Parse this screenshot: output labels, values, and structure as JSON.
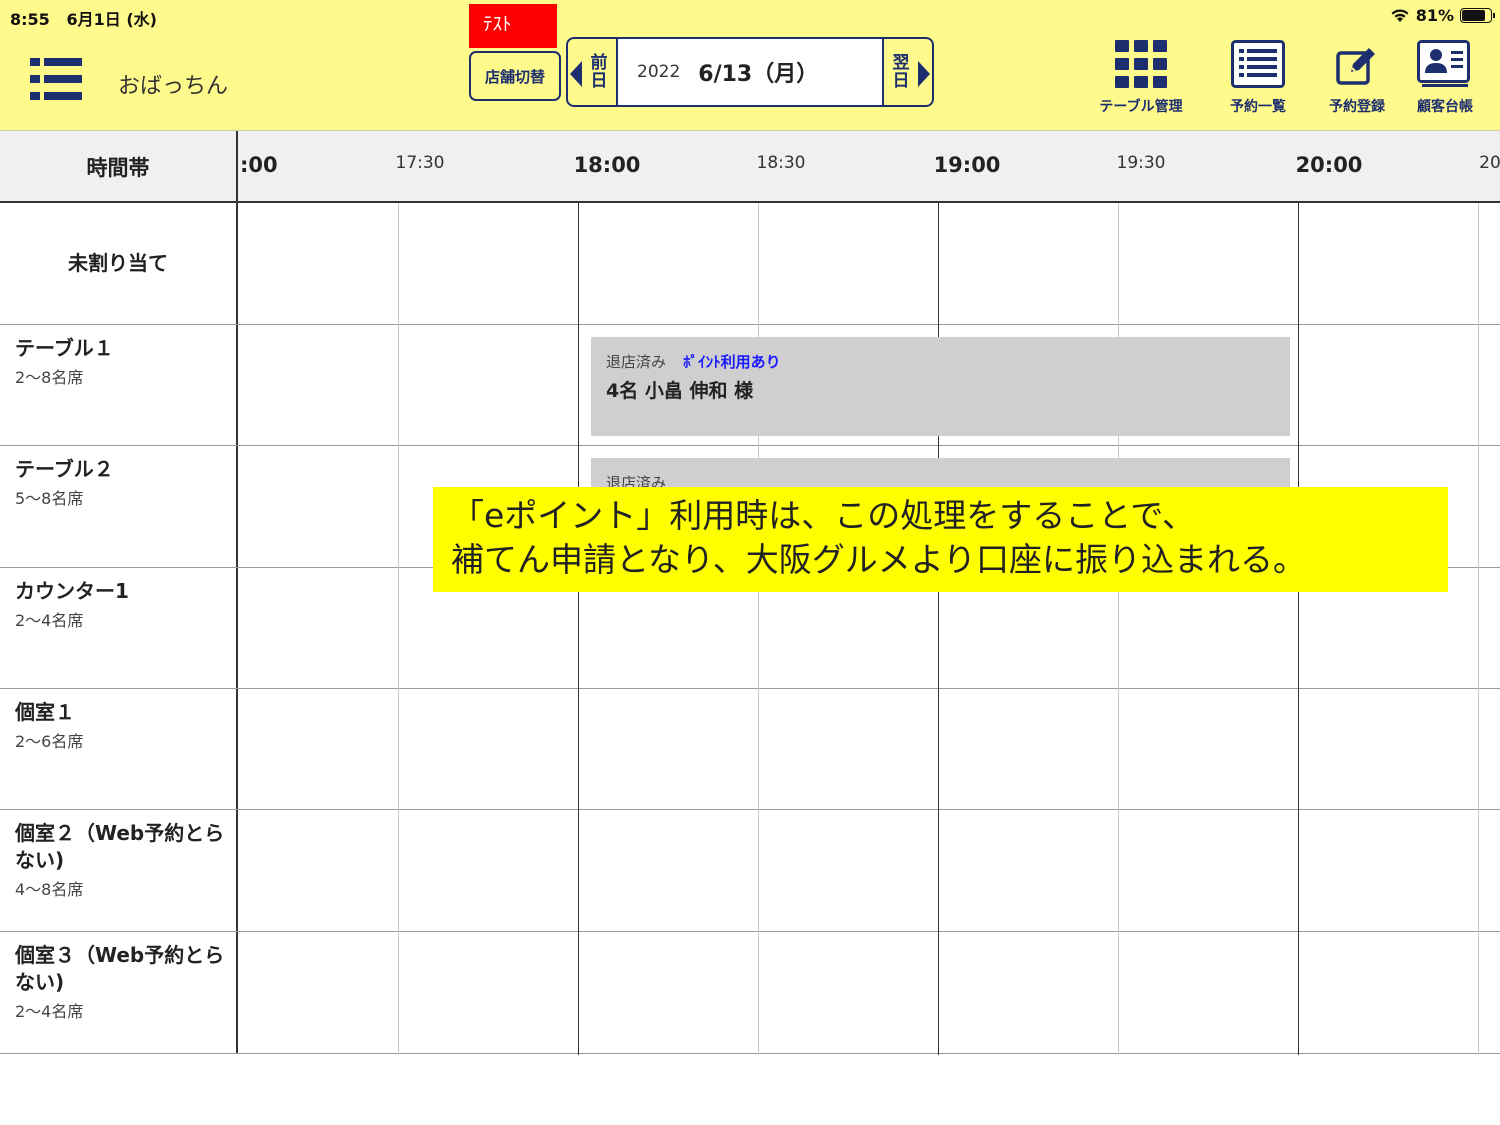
{
  "status_bar": {
    "time": "8:55",
    "date": "6月1日 (水)",
    "battery": "81%",
    "battery_level": 0.81
  },
  "header": {
    "store_name": "おばっちん",
    "test_badge": "ﾃｽﾄ",
    "store_switch": "店舗切替",
    "prev_day": [
      "前",
      "日"
    ],
    "next_day": [
      "翌",
      "日"
    ],
    "date_year": "2022",
    "date_main": "6/13（月）",
    "actions": [
      {
        "label": "テーブル管理",
        "icon": "grid-icon"
      },
      {
        "label": "予約一覧",
        "icon": "list-icon"
      },
      {
        "label": "予約登録",
        "icon": "edit-icon"
      },
      {
        "label": "顧客台帳",
        "icon": "contact-card-icon"
      }
    ]
  },
  "timeline": {
    "column_title": "時間帯",
    "labels": [
      {
        "text": ":00",
        "major": true
      },
      {
        "text": "17:30",
        "major": false
      },
      {
        "text": "18:00",
        "major": true
      },
      {
        "text": "18:30",
        "major": false
      },
      {
        "text": "19:00",
        "major": true
      },
      {
        "text": "19:30",
        "major": false
      },
      {
        "text": "20:00",
        "major": true
      },
      {
        "text": "20",
        "major": false
      }
    ]
  },
  "rows": [
    {
      "name": "未割り当て",
      "seats": ""
    },
    {
      "name": "テーブル１",
      "seats": "2〜8名席"
    },
    {
      "name": "テーブル２",
      "seats": "5〜8名席"
    },
    {
      "name": "カウンター1",
      "seats": "2〜4名席"
    },
    {
      "name": "個室１",
      "seats": "2〜6名席"
    },
    {
      "name": "個室２（Web予約とらない)",
      "seats": "4〜8名席"
    },
    {
      "name": "個室３（Web予約とらない)",
      "seats": "2〜4名席"
    }
  ],
  "reservations": [
    {
      "status": "退店済み",
      "point": "ﾎﾟｲﾝﾄ利用あり",
      "guest": "4名 小畠 伸和 様"
    },
    {
      "status": "退店済み",
      "point": "",
      "guest": ""
    }
  ],
  "callout": {
    "line1": "「eポイント」利用時は、この処理をすることで、",
    "line2": "補てん申請となり、大阪グルメより口座に振り込まれる。"
  }
}
